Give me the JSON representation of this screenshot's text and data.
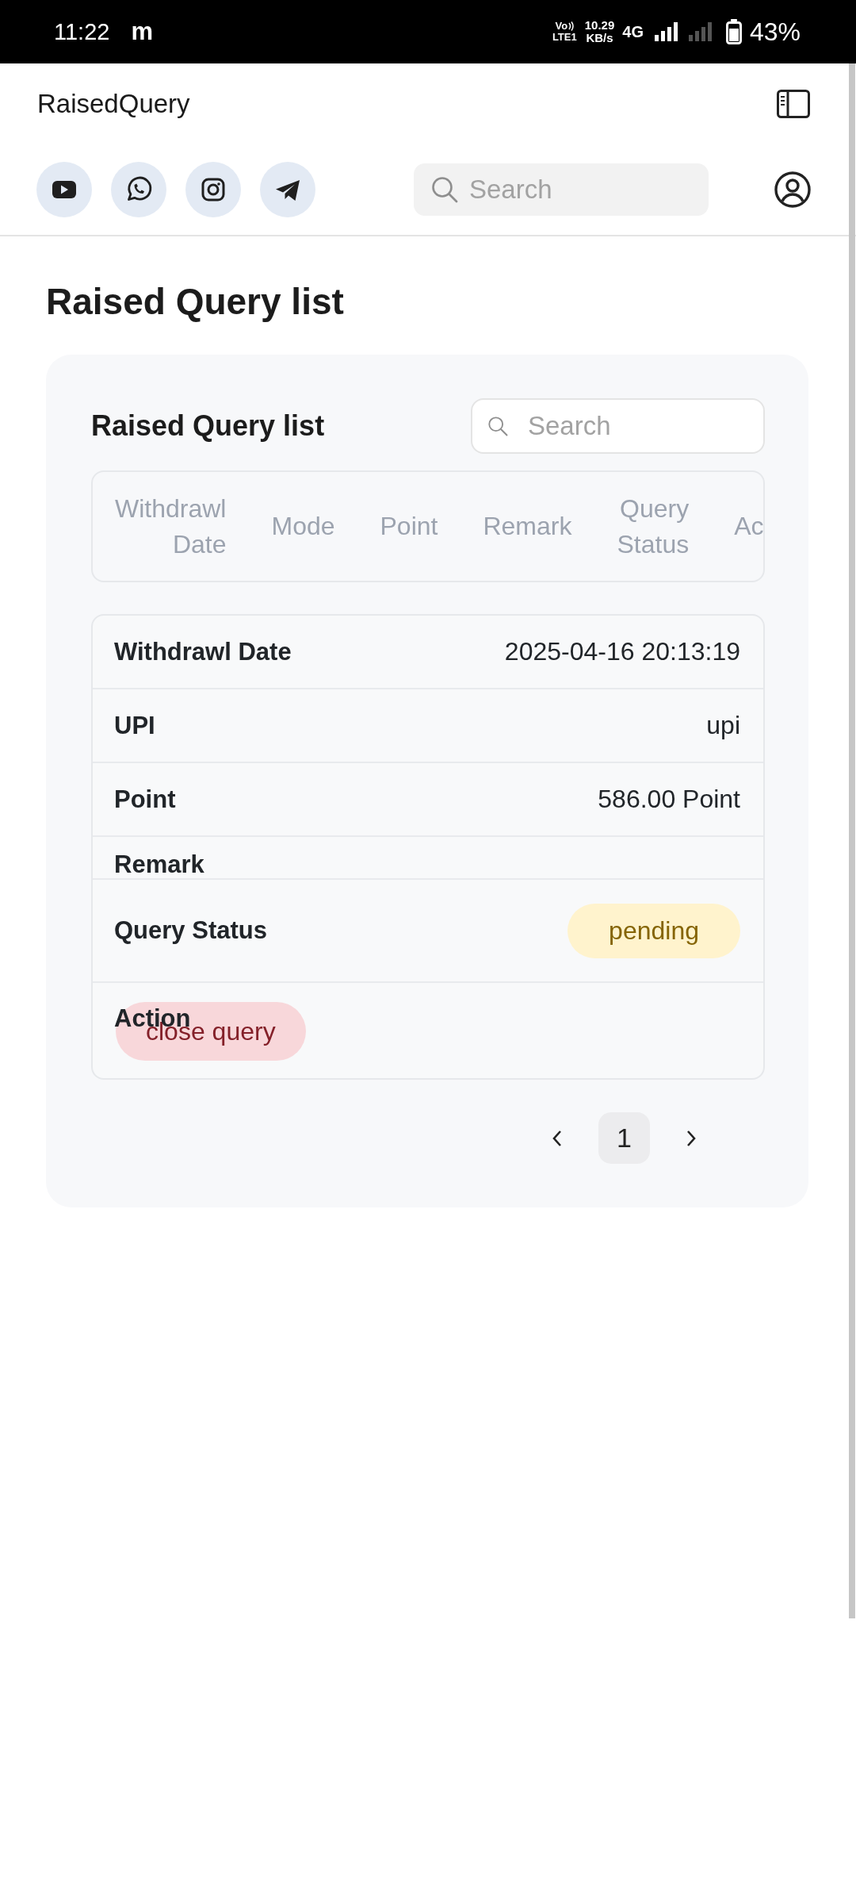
{
  "status_bar": {
    "time": "11:22",
    "notification_glyph": "m",
    "volte": [
      "Vo",
      "LTE1"
    ],
    "net_speed": [
      "10.29",
      "KB/s"
    ],
    "network": "4G",
    "battery": "43%"
  },
  "header": {
    "title": "RaisedQuery"
  },
  "toolbar": {
    "search": {
      "placeholder": "Search"
    }
  },
  "page": {
    "title": "Raised Query list"
  },
  "card": {
    "title": "Raised Query list",
    "search": {
      "placeholder": "Search"
    },
    "table": {
      "columns": [
        "Withdrawl Date",
        "Mode",
        "Point",
        "Remark",
        "Query Status",
        "Ac"
      ]
    },
    "record": {
      "fields": [
        {
          "kind": "text",
          "label": "Withdrawl Date",
          "value": "2025-04-16 20:13:19"
        },
        {
          "kind": "text",
          "label": "UPI",
          "value": "upi"
        },
        {
          "kind": "text",
          "label": "Point",
          "value": "586.00 Point"
        },
        {
          "kind": "covered",
          "label": "Remark"
        },
        {
          "kind": "badge",
          "label": "Query Status",
          "value": "pending"
        },
        {
          "kind": "action",
          "label": "Action",
          "button": "close query"
        }
      ]
    },
    "pagination": {
      "pages": [
        {
          "label": "1",
          "selected": true
        }
      ]
    }
  }
}
